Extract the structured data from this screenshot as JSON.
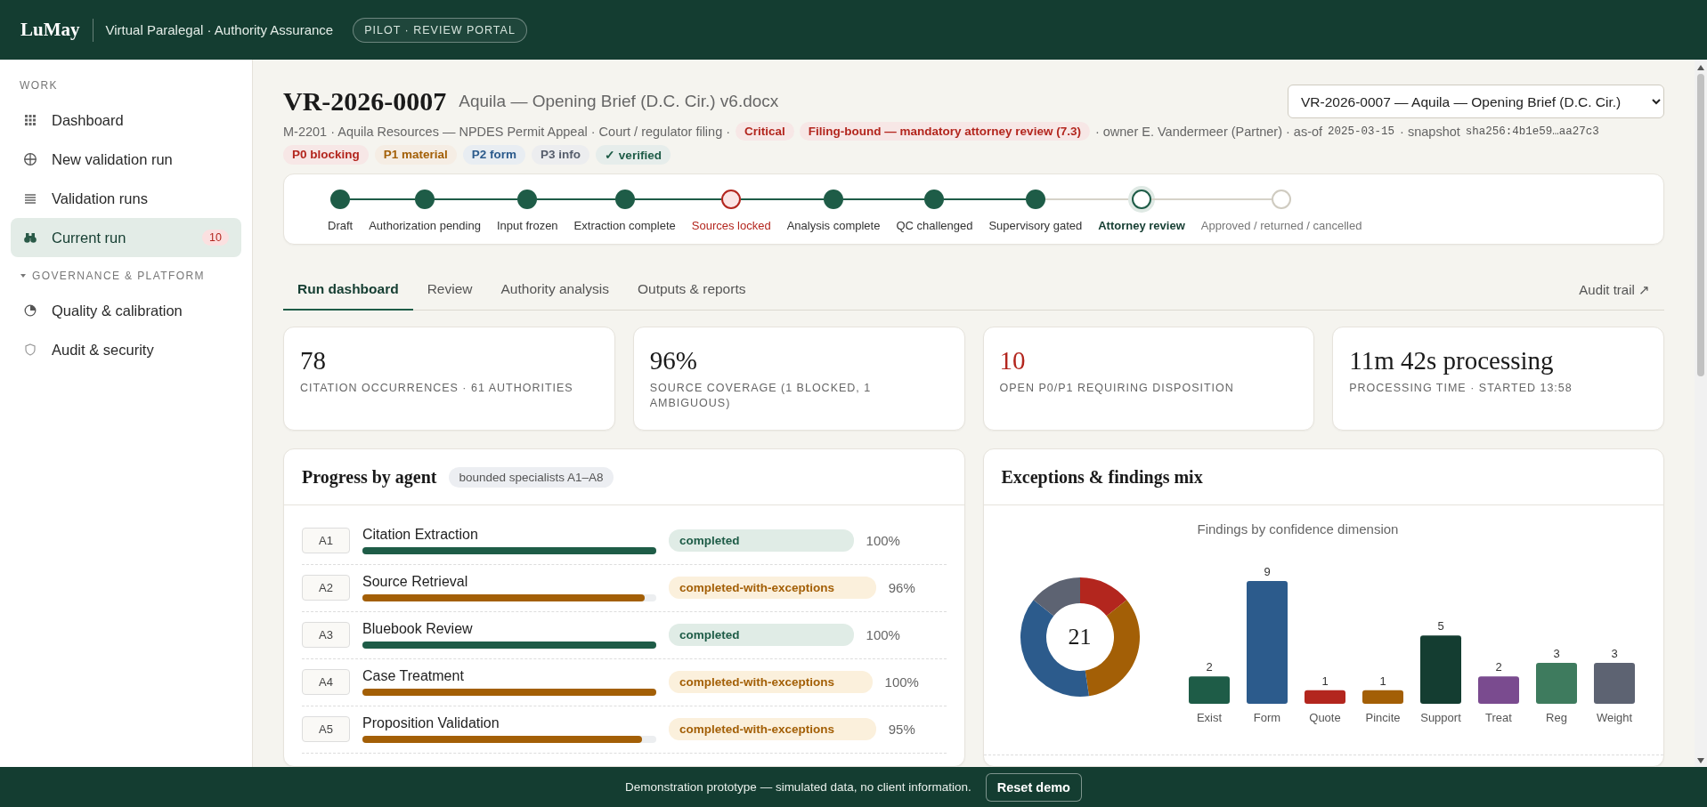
{
  "header": {
    "logo": "LuMay",
    "subtitle": "Virtual Paralegal · Authority Assurance",
    "badge": "PILOT · REVIEW PORTAL"
  },
  "sidebar": {
    "sections": [
      {
        "title": "WORK",
        "items": [
          {
            "label": "Dashboard",
            "selected": false
          },
          {
            "label": "New validation run",
            "selected": false
          },
          {
            "label": "Validation runs",
            "selected": false
          },
          {
            "label": "Current run",
            "selected": true,
            "count": "10"
          }
        ]
      },
      {
        "title": "GOVERNANCE & PLATFORM",
        "expanded": true,
        "items": [
          {
            "label": "Quality & calibration",
            "selected": false
          },
          {
            "label": "Audit & security",
            "selected": false
          }
        ]
      }
    ]
  },
  "run": {
    "id": "VR-2026-0007",
    "file": "Aquila — Opening Brief (D.C. Cir.) v6.docx",
    "selector": {
      "value": "VR-2026-0007 — Aquila — Opening Brief (D.C. Cir.)"
    },
    "meta": [
      {
        "kind": "text",
        "text": "M-2201 · Aquila Resources — NPDES Permit Appeal · Court / regulator filing ·"
      },
      {
        "kind": "tag",
        "text": "Critical",
        "color": "#b3261e"
      },
      {
        "kind": "tag",
        "text": "Filing-bound — mandatory attorney review (7.3)",
        "color": "#b3261e"
      },
      {
        "kind": "text",
        "text": "· owner E. Vandermeer (Partner) · as-of"
      },
      {
        "kind": "mono",
        "text": "2025-03-15"
      },
      {
        "kind": "text",
        "text": "· snapshot"
      },
      {
        "kind": "mono",
        "text": "sha256:4b1e59…aa27c3"
      }
    ],
    "legend": [
      {
        "text": "P0 blocking",
        "color": "#b3261e"
      },
      {
        "text": "P1 material",
        "color": "#a35f06"
      },
      {
        "text": "P2 form",
        "color": "#2c5b8c"
      },
      {
        "text": "P3 info",
        "color": "#555d6b"
      },
      {
        "text": "✓ verified",
        "color": "#1e5c47"
      }
    ]
  },
  "stepper": [
    {
      "label": "Draft",
      "kind": "done"
    },
    {
      "label": "Authorization pending",
      "kind": "done"
    },
    {
      "label": "Input frozen",
      "kind": "done"
    },
    {
      "label": "Extraction complete",
      "kind": "done"
    },
    {
      "label": "Sources locked",
      "kind": "flagged"
    },
    {
      "label": "Analysis complete",
      "kind": "done"
    },
    {
      "label": "QC challenged",
      "kind": "done"
    },
    {
      "label": "Supervisory gated",
      "kind": "done"
    },
    {
      "label": "Attorney review",
      "kind": "current"
    },
    {
      "label": "Approved / returned / cancelled",
      "kind": "pending"
    }
  ],
  "tabs": [
    {
      "label": "Run dashboard",
      "selected": true
    },
    {
      "label": "Review",
      "selected": false
    },
    {
      "label": "Authority analysis",
      "selected": false
    },
    {
      "label": "Outputs & reports",
      "selected": false
    }
  ],
  "audit_link": "Audit trail ↗",
  "stats": [
    {
      "value": "78",
      "label": "CITATION OCCURRENCES · 61 AUTHORITIES",
      "alert": false
    },
    {
      "value": "96%",
      "label": "SOURCE COVERAGE (1 BLOCKED, 1 AMBIGUOUS)",
      "alert": false
    },
    {
      "value": "10",
      "label": "OPEN P0/P1 REQUIRING DISPOSITION",
      "alert": true
    },
    {
      "value": "11m 42s processing",
      "label": "PROCESSING TIME · STARTED 13:58",
      "alert": false
    }
  ],
  "agents": {
    "title": "Progress by agent",
    "tag": "bounded specialists A1–A8",
    "rows": [
      {
        "id": "A1",
        "name": "Citation Extraction",
        "level": 1.0,
        "kind": "completed",
        "status": "completed",
        "percent": "100%"
      },
      {
        "id": "A2",
        "name": "Source Retrieval",
        "level": 0.96,
        "kind": "exceptions",
        "status": "completed-with-exceptions",
        "percent": "96%"
      },
      {
        "id": "A3",
        "name": "Bluebook Review",
        "level": 1.0,
        "kind": "completed",
        "status": "completed",
        "percent": "100%"
      },
      {
        "id": "A4",
        "name": "Case Treatment",
        "level": 1.0,
        "kind": "exceptions",
        "status": "completed-with-exceptions",
        "percent": "100%"
      },
      {
        "id": "A5",
        "name": "Proposition Validation",
        "level": 0.95,
        "kind": "exceptions",
        "status": "completed-with-exceptions",
        "percent": "95%"
      }
    ]
  },
  "findings": {
    "title": "Exceptions & findings mix",
    "donut_total": "21",
    "chart_data": {
      "type": "bar",
      "title": "Findings by confidence dimension",
      "categories": [
        "Exist",
        "Form",
        "Quote",
        "Pincite",
        "Support",
        "Treat",
        "Reg",
        "Weight"
      ],
      "values": [
        2,
        9,
        1,
        1,
        5,
        2,
        3,
        3
      ],
      "colors": [
        "#1e5c47",
        "#2c5b8c",
        "#b3261e",
        "#a35f06",
        "#143d31",
        "#7a4b8f",
        "#3e7b5e",
        "#5d6372"
      ],
      "data_labels": true
    }
  },
  "footer": {
    "notice": "Demonstration prototype — simulated data, no client information.",
    "button": "Reset demo"
  }
}
